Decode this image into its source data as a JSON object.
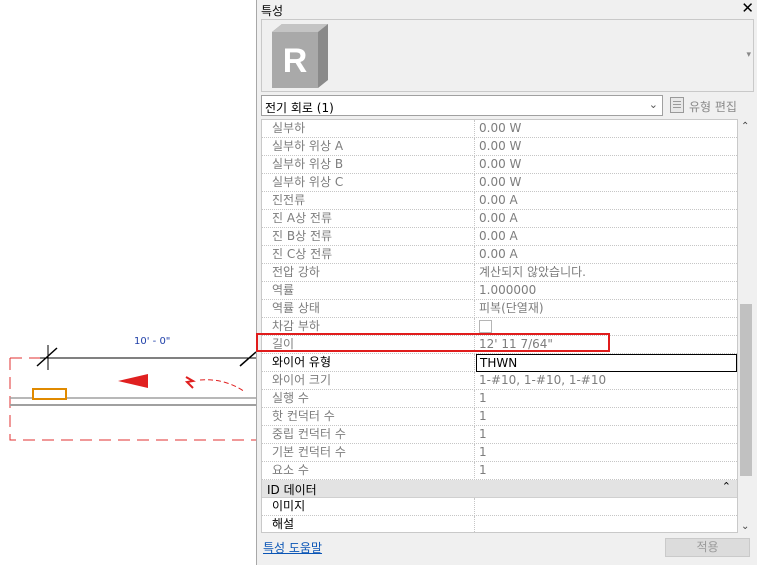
{
  "canvas": {
    "dimension_label": "10' - 0\""
  },
  "palette": {
    "title": "특성",
    "close_label": "✕",
    "type_selector": {
      "logo_letter": "R",
      "scroll_arrow": "▾"
    },
    "instance_selector": {
      "value": "전기 회로 (1)",
      "arrow": "⌄"
    },
    "edit_type_label": "유형 편집",
    "properties": [
      {
        "name": "실부하",
        "value": "0.00 W"
      },
      {
        "name": "실부하 위상 A",
        "value": "0.00 W"
      },
      {
        "name": "실부하 위상 B",
        "value": "0.00 W"
      },
      {
        "name": "실부하 위상 C",
        "value": "0.00 W"
      },
      {
        "name": "진전류",
        "value": "0.00 A"
      },
      {
        "name": "진 A상 전류",
        "value": "0.00 A"
      },
      {
        "name": "진 B상 전류",
        "value": "0.00 A"
      },
      {
        "name": "진 C상 전류",
        "value": "0.00 A"
      },
      {
        "name": "전압 강하",
        "value": "계산되지 않았습니다."
      },
      {
        "name": "역률",
        "value": "1.000000"
      },
      {
        "name": "역률 상태",
        "value": "피복(단열재)"
      },
      {
        "name": "차감 부하",
        "value": ""
      },
      {
        "name": "길이",
        "value": "12'  11 7/64\""
      },
      {
        "name": "와이어 유형",
        "value": "THWN"
      },
      {
        "name": "와이어 크기",
        "value": "1-#10, 1-#10, 1-#10"
      },
      {
        "name": "실행 수",
        "value": "1"
      },
      {
        "name": "핫 컨덕터 수",
        "value": "1"
      },
      {
        "name": "중립 컨덕터 수",
        "value": "1"
      },
      {
        "name": "기본 컨덕터 수",
        "value": "1"
      },
      {
        "name": "요소 수",
        "value": "1"
      }
    ],
    "group_identity": {
      "title": "ID 데이터",
      "collapse_icon": "⌃"
    },
    "identity_properties": [
      {
        "name": "이미지",
        "value": ""
      },
      {
        "name": "해설",
        "value": ""
      }
    ],
    "scroll_up": "⌃",
    "scroll_down": "⌄",
    "help_link": "특성 도움말",
    "apply_label": "적용"
  }
}
